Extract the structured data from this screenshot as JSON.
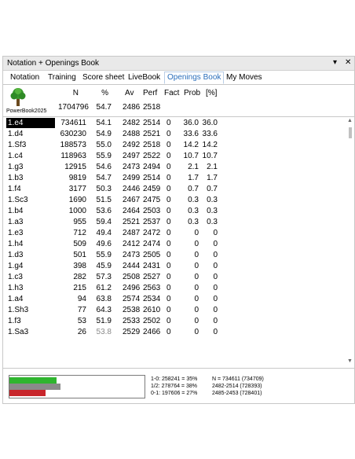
{
  "window": {
    "title": "Notation + Openings Book",
    "menu_icon": "▾",
    "close_icon": "✕"
  },
  "tabs": [
    "Notation",
    "Training",
    "Score sheet",
    "LiveBook",
    "Openings Book",
    "My Moves"
  ],
  "active_tab": "Openings Book",
  "book": {
    "name": "PowerBook2025",
    "icon": "tree-icon",
    "headers": [
      "N",
      "%",
      "Av",
      "Perf",
      "Fact",
      "Prob",
      "[%]"
    ],
    "summary": {
      "n": "1704796",
      "pct": "54.7",
      "av": "2486",
      "perf": "2518"
    }
  },
  "moves": [
    [
      "1.e4",
      "734611",
      "54.1",
      "2482",
      "2514",
      "0",
      "36.0",
      "36.0"
    ],
    [
      "1.d4",
      "630230",
      "54.9",
      "2488",
      "2521",
      "0",
      "33.6",
      "33.6"
    ],
    [
      "1.Sf3",
      "188573",
      "55.0",
      "2492",
      "2518",
      "0",
      "14.2",
      "14.2"
    ],
    [
      "1.c4",
      "118963",
      "55.9",
      "2497",
      "2522",
      "0",
      "10.7",
      "10.7"
    ],
    [
      "1.g3",
      "12915",
      "54.6",
      "2473",
      "2494",
      "0",
      "2.1",
      "2.1"
    ],
    [
      "1.b3",
      "9819",
      "54.7",
      "2499",
      "2514",
      "0",
      "1.7",
      "1.7"
    ],
    [
      "1.f4",
      "3177",
      "50.3",
      "2446",
      "2459",
      "0",
      "0.7",
      "0.7"
    ],
    [
      "1.Sc3",
      "1690",
      "51.5",
      "2467",
      "2475",
      "0",
      "0.3",
      "0.3"
    ],
    [
      "1.b4",
      "1000",
      "53.6",
      "2464",
      "2503",
      "0",
      "0.3",
      "0.3"
    ],
    [
      "1.a3",
      "955",
      "59.4",
      "2521",
      "2537",
      "0",
      "0.3",
      "0.3"
    ],
    [
      "1.e3",
      "712",
      "49.4",
      "2487",
      "2472",
      "0",
      "0",
      "0"
    ],
    [
      "1.h4",
      "509",
      "49.6",
      "2412",
      "2474",
      "0",
      "0",
      "0"
    ],
    [
      "1.d3",
      "501",
      "55.9",
      "2473",
      "2505",
      "0",
      "0",
      "0"
    ],
    [
      "1.g4",
      "398",
      "45.9",
      "2444",
      "2431",
      "0",
      "0",
      "0"
    ],
    [
      "1.c3",
      "282",
      "57.3",
      "2508",
      "2527",
      "0",
      "0",
      "0"
    ],
    [
      "1.h3",
      "215",
      "61.2",
      "2496",
      "2563",
      "0",
      "0",
      "0"
    ],
    [
      "1.a4",
      "94",
      "63.8",
      "2574",
      "2534",
      "0",
      "0",
      "0"
    ],
    [
      "1.Sh3",
      "77",
      "64.3",
      "2538",
      "2610",
      "0",
      "0",
      "0"
    ],
    [
      "1.f3",
      "53",
      "51.9",
      "2533",
      "2502",
      "0",
      "0",
      "0"
    ],
    [
      "1.Sa3",
      "26",
      "53.8",
      "2529",
      "2466",
      "0",
      "0",
      "0"
    ]
  ],
  "grey_cells": [
    [
      19,
      2
    ]
  ],
  "selected_row": 0,
  "stats": {
    "white_win": "1-0: 258241 = 35%",
    "draw": "1/2: 278764 = 38%",
    "black_win": "0-1: 197606 = 27%",
    "n": "N = 734611 (734709)",
    "range1": "2482-2514 (728393)",
    "range2": "2485-2453 (728401)"
  },
  "bars": [
    {
      "color": "#2fb52f",
      "fraction": 0.35
    },
    {
      "color": "#8a8a8a",
      "fraction": 0.38
    },
    {
      "color": "#c8262b",
      "fraction": 0.27
    }
  ],
  "colors": {
    "accent": "#2a6ebb"
  }
}
